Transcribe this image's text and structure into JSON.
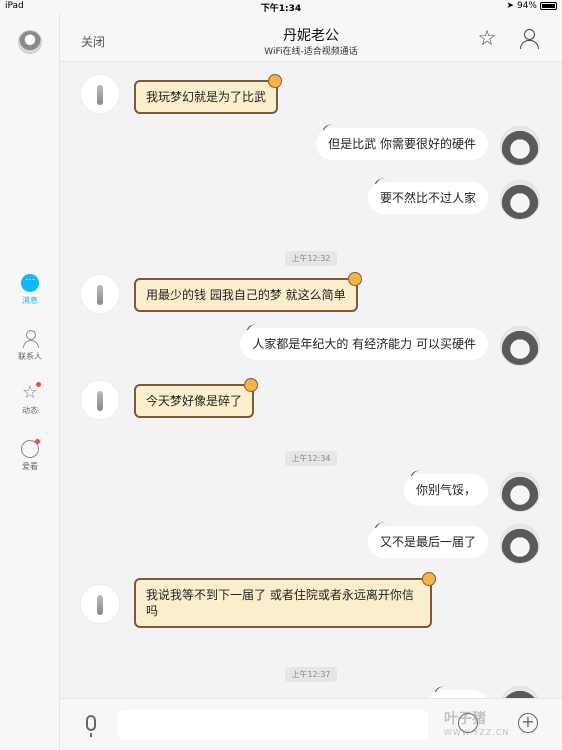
{
  "status_bar": {
    "device": "iPad",
    "time": "下午1:34",
    "battery": "94%"
  },
  "sidebar": {
    "items": [
      {
        "label": "消息",
        "icon": "message-icon",
        "active": true
      },
      {
        "label": "联系人",
        "icon": "contacts-icon",
        "active": false
      },
      {
        "label": "动态",
        "icon": "star-icon",
        "active": false
      },
      {
        "label": "爱看",
        "icon": "watch-icon",
        "active": false
      }
    ]
  },
  "header": {
    "close_label": "关闭",
    "title": "丹妮老公",
    "subtitle": "WiFi在线-适合视频通话"
  },
  "messages": [
    {
      "side": "left",
      "text": "我玩梦幻就是为了比武"
    },
    {
      "side": "right",
      "text": "但是比武 你需要很好的硬件"
    },
    {
      "side": "right",
      "text": "要不然比不过人家"
    },
    {
      "type": "time",
      "text": "上午12:32"
    },
    {
      "side": "left",
      "text": "用最少的钱 园我自己的梦 就这么简单"
    },
    {
      "side": "right",
      "text": "人家都是年纪大的 有经济能力 可以买硬件"
    },
    {
      "side": "left",
      "text": "今天梦好像是碎了"
    },
    {
      "type": "time",
      "text": "上午12:34"
    },
    {
      "side": "right",
      "text": "你别气馁，"
    },
    {
      "side": "right",
      "text": "又不是最后一届了"
    },
    {
      "side": "left",
      "text": "我说我等不到下一届了 或者住院或者永远离开你信吗"
    },
    {
      "type": "time",
      "text": "上午12:37"
    }
  ],
  "input": {
    "value": ""
  },
  "watermark": {
    "brand": "叶子猪",
    "url": "WWW.YZZ.CN"
  },
  "colors": {
    "accent": "#12b7f5",
    "bubble_left": "#fbeecd",
    "bubble_left_border": "#7b5a3a",
    "bubble_right": "#ffffff"
  }
}
